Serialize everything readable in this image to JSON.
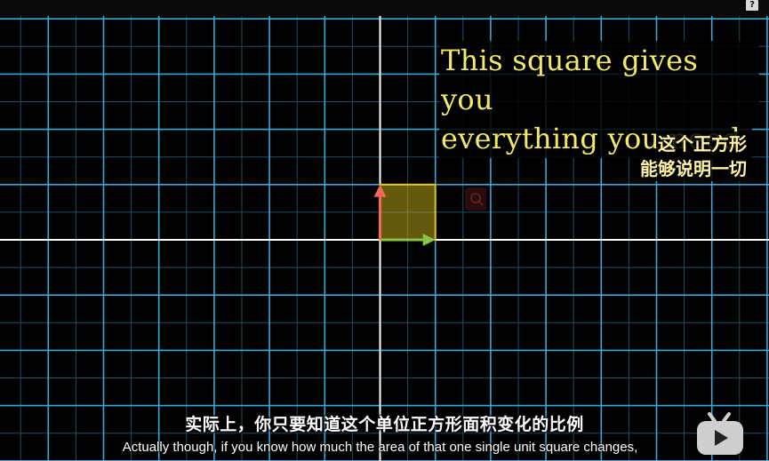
{
  "top_bar": {
    "help_label": "?"
  },
  "annotation": {
    "en_line1": "This square gives you",
    "en_line2": "everything you need.",
    "zh_line1": "这个正方形",
    "zh_line2": "能够说明一切"
  },
  "subtitles": {
    "zh": "实际上，你只要知道这个单位正方形面积变化的比例",
    "en": "Actually though, if you know how much the area of that one single unit square changes,"
  },
  "colors": {
    "background": "#000000",
    "grid_line": "#3aa8d8",
    "axis_line": "#ffffff",
    "square_fill": "#b8a317",
    "square_stroke": "#e0c81a",
    "i_hat": "#8bc34a",
    "j_hat": "#f26b5b",
    "caption_yellow": "#f2e86a"
  },
  "icons": {
    "help": "help-icon",
    "magnifier": "magnifier-icon",
    "player_logo": "tv-logo-icon"
  }
}
